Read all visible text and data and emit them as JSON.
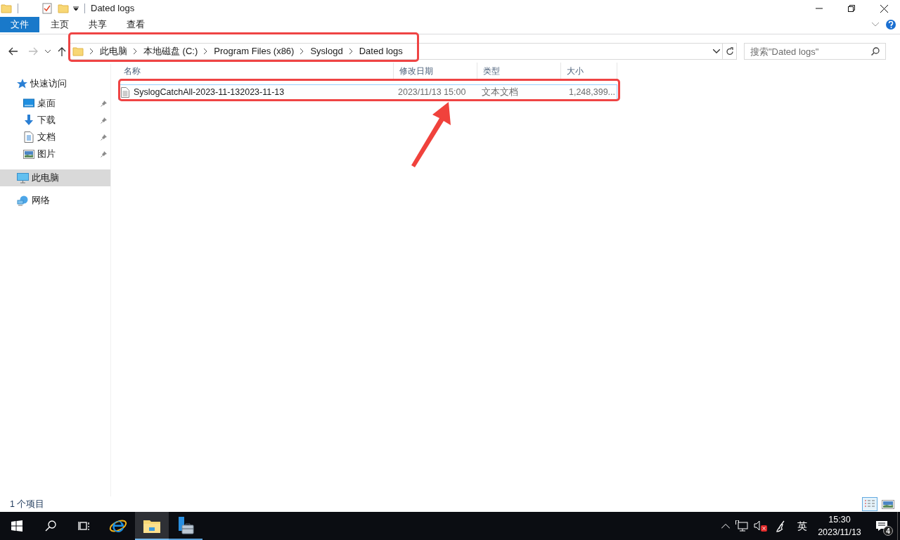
{
  "window": {
    "title": "Dated logs"
  },
  "ribbon": {
    "tabs": [
      {
        "label": "文件",
        "kind": "file"
      },
      {
        "label": "主页",
        "kind": "tab"
      },
      {
        "label": "共享",
        "kind": "tab"
      },
      {
        "label": "查看",
        "kind": "tab"
      }
    ]
  },
  "address": {
    "breadcrumbs": [
      "此电脑",
      "本地磁盘 (C:)",
      "Program Files (x86)",
      "Syslogd",
      "Dated logs"
    ],
    "search_placeholder": "搜索\"Dated logs\""
  },
  "sidebar": {
    "items": [
      {
        "label": "快速访问",
        "selected": false,
        "children": [
          {
            "label": "桌面",
            "pinned": true
          },
          {
            "label": "下载",
            "pinned": true
          },
          {
            "label": "文档",
            "pinned": true
          },
          {
            "label": "图片",
            "pinned": true
          }
        ]
      },
      {
        "label": "此电脑",
        "selected": true
      },
      {
        "label": "网络",
        "selected": false
      }
    ]
  },
  "table": {
    "columns": [
      "名称",
      "修改日期",
      "类型",
      "大小"
    ],
    "rows": [
      {
        "cells": [
          "SyslogCatchAll-2023-11-132023-11-13",
          "2023/11/13 15:00",
          "文本文档",
          "1,248,399..."
        ],
        "selected": true
      }
    ]
  },
  "status_bar": {
    "text": "1 个项目",
    "views": [
      {
        "selected": true
      },
      {
        "selected": false
      }
    ]
  },
  "taskbar": {
    "apps": [
      {
        "active": false,
        "open": false
      },
      {
        "active": true,
        "open": true
      },
      {
        "active": false,
        "open": true
      }
    ],
    "ime": "英",
    "time": "15:30",
    "date": "2023/11/13",
    "notifications": "4"
  }
}
